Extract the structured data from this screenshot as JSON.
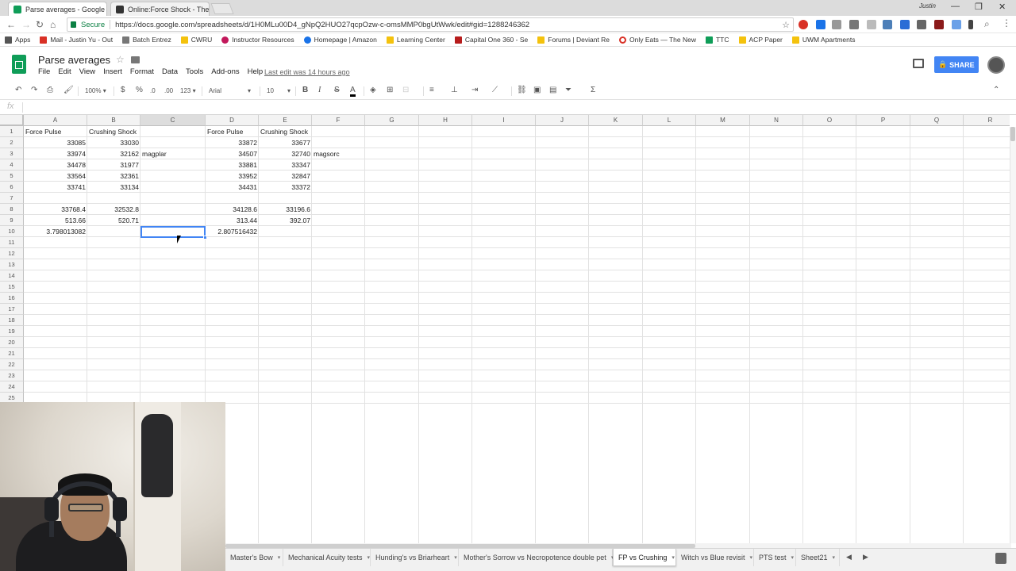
{
  "browser": {
    "tabs": [
      {
        "title": "Parse averages - Google",
        "active": true,
        "fav_color": "#0f9d58"
      },
      {
        "title": "Online:Force Shock - The",
        "active": false,
        "fav_color": "#333333"
      }
    ],
    "profile": "Justin",
    "secure_label": "Secure",
    "url": "https://docs.google.com/spreadsheets/d/1H0MLu00D4_gNpQ2HUO27qcpOzw-c-omsMMP0bgUtWwk/edit#gid=1288246362",
    "bookmarks": [
      {
        "label": "Apps",
        "color": "#555555"
      },
      {
        "label": "Mail - Justin Yu - Out",
        "color": "#d93025"
      },
      {
        "label": "Batch Entrez",
        "color": "#777777"
      },
      {
        "label": "CWRU",
        "color": "#f4c20d"
      },
      {
        "label": "Instructor Resources",
        "color": "#c2185b"
      },
      {
        "label": "Homepage | Amazon",
        "color": "#1a73e8"
      },
      {
        "label": "Learning Center",
        "color": "#f4c20d"
      },
      {
        "label": "Capital One 360 - Se",
        "color": "#b71c1c"
      },
      {
        "label": "Forums | Deviant Re",
        "color": "#f4c20d"
      },
      {
        "label": "Only Eats — The New",
        "color": "#d93025"
      },
      {
        "label": "TTC",
        "color": "#0f9d58"
      },
      {
        "label": "ACP Paper",
        "color": "#f4c20d"
      },
      {
        "label": "UWM Apartments",
        "color": "#f4c20d"
      }
    ]
  },
  "doc": {
    "title": "Parse averages",
    "menu": [
      "File",
      "Edit",
      "View",
      "Insert",
      "Format",
      "Data",
      "Tools",
      "Add-ons",
      "Help"
    ],
    "last_edit": "Last edit was 14 hours ago",
    "share_label": "SHARE"
  },
  "toolbar": {
    "zoom": "100%",
    "currency": "$",
    "percent": "%",
    "dec_less": ".0",
    "dec_more": ".00",
    "more_formats": "123",
    "font": "Arial",
    "font_size": "10",
    "bold": "B",
    "italic": "I",
    "strike": "S",
    "text_color": "A",
    "functions": "Σ"
  },
  "formula_bar": {
    "fx": "fx",
    "value": ""
  },
  "grid": {
    "columns": [
      "A",
      "B",
      "C",
      "D",
      "E",
      "F",
      "G",
      "H",
      "I",
      "J",
      "K",
      "L",
      "M",
      "N",
      "O",
      "P",
      "Q",
      "R"
    ],
    "rows": [
      "1",
      "2",
      "3",
      "4",
      "5",
      "6",
      "7",
      "8",
      "9",
      "10",
      "11",
      "12",
      "13",
      "14",
      "15",
      "16",
      "17",
      "18",
      "19",
      "20",
      "21",
      "22",
      "23",
      "24",
      "25"
    ],
    "selected_cell": "C10",
    "cells": {
      "A1": "Force Pulse",
      "B1": "Crushing Shock",
      "D1": "Force Pulse",
      "E1": "Crushing Shock",
      "A2": "33085",
      "B2": "33030",
      "D2": "33872",
      "E2": "33677",
      "A3": "33974",
      "B3": "32162",
      "C3": "magplar",
      "D3": "34507",
      "E3": "32740",
      "F3": "magsorc",
      "A4": "34478",
      "B4": "31977",
      "D4": "33881",
      "E4": "33347",
      "A5": "33564",
      "B5": "32361",
      "D5": "33952",
      "E5": "32847",
      "A6": "33741",
      "B6": "33134",
      "D6": "34431",
      "E6": "33372",
      "A8": "33768.4",
      "B8": "32532.8",
      "D8": "34128.6",
      "E8": "33196.6",
      "A9": "513.66",
      "B9": "520.71",
      "D9": "313.44",
      "E9": "392.07",
      "A10": "3.798013082",
      "D10": "2.807516432"
    }
  },
  "sheets": {
    "tabs": [
      "Master's Bow",
      "Mechanical Acuity tests",
      "Hunding's vs Briarheart",
      "Mother's Sorrow vs Necropotence double pet",
      "FP vs Crushing",
      "Witch vs Blue revisit",
      "PTS test",
      "Sheet21"
    ],
    "active": "FP vs Crushing"
  }
}
